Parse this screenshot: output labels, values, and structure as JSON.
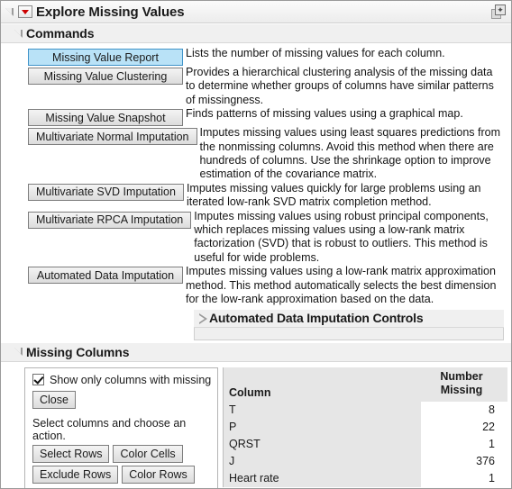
{
  "window": {
    "title": "Explore Missing Values",
    "menu_icon": "red-triangle-menu-icon",
    "corner_icon": "window-restore-icon"
  },
  "commands": {
    "header": "Commands",
    "items": [
      {
        "label": "Missing Value Report",
        "description": "Lists the number of missing values for each column.",
        "selected": true
      },
      {
        "label": "Missing Value Clustering",
        "description": "Provides a hierarchical clustering analysis of the missing data to determine whether groups of columns have similar patterns of missingness.",
        "selected": false
      },
      {
        "label": "Missing Value Snapshot",
        "description": "Finds patterns of missing values using a graphical map.",
        "selected": false
      },
      {
        "label": "Multivariate Normal Imputation",
        "description": "Imputes missing values using least squares predictions from the nonmissing columns. Avoid this method when there are hundreds of columns. Use the shrinkage option to improve estimation of the covariance matrix.",
        "selected": false
      },
      {
        "label": "Multivariate SVD Imputation",
        "description": "Imputes missing values quickly for large problems using an iterated low-rank SVD matrix completion method.",
        "selected": false
      },
      {
        "label": "Multivariate RPCA Imputation",
        "description": "Imputes missing values using robust principal components, which replaces missing values using a low-rank matrix factorization (SVD) that is robust to outliers. This method is useful for wide problems.",
        "selected": false
      },
      {
        "label": "Automated Data Imputation",
        "description": "Imputes missing values using a low-rank matrix approximation method. This method automatically selects the best dimension for the low-rank approximation based on the data.",
        "selected": false
      }
    ],
    "adi_controls": {
      "label": "Automated Data Imputation Controls",
      "expanded": false
    }
  },
  "missing_columns": {
    "header": "Missing Columns",
    "checkbox": {
      "label": "Show only columns with missing",
      "checked": true
    },
    "close_label": "Close",
    "hint": "Select columns and choose an action.",
    "actions": [
      "Select Rows",
      "Color Cells",
      "Exclude Rows",
      "Color Rows"
    ],
    "table": {
      "col_header": "Column",
      "num_header_line1": "Number",
      "num_header_line2": "Missing",
      "rows": [
        {
          "column": "T",
          "missing": "8"
        },
        {
          "column": "P",
          "missing": "22"
        },
        {
          "column": "QRST",
          "missing": "1"
        },
        {
          "column": "J",
          "missing": "376"
        },
        {
          "column": "Heart rate",
          "missing": "1"
        }
      ]
    }
  },
  "colors": {
    "selection": "#b9e2f7",
    "selection_border": "#3f93c8",
    "menu_red": "#cc0000",
    "panel_gray": "#f0f0f0",
    "table_row_gray": "#e6e6e6"
  }
}
